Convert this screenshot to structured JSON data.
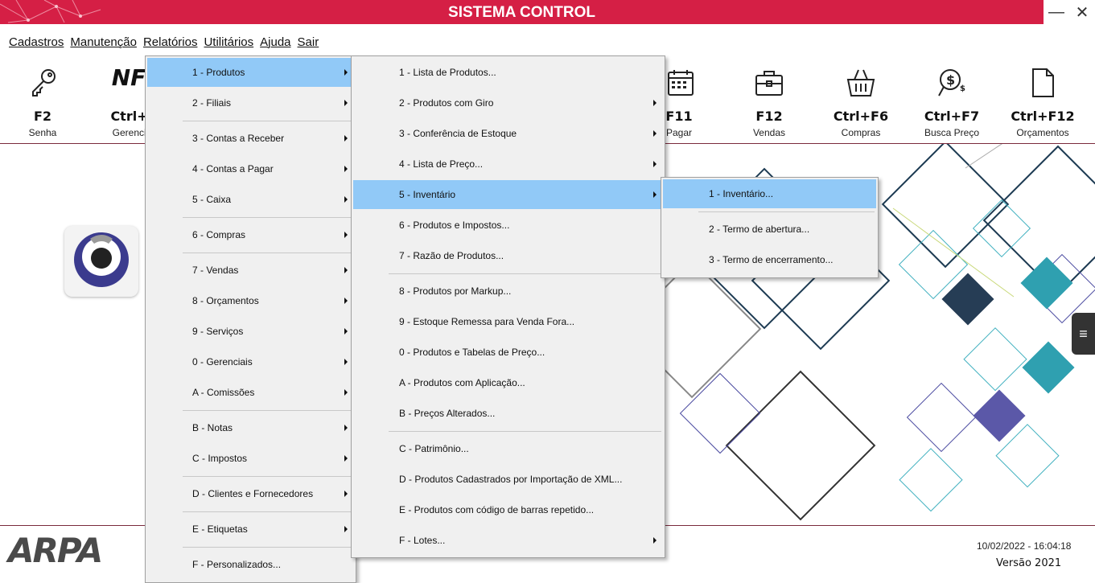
{
  "window": {
    "title": "SISTEMA CONTROL",
    "minimize_glyph": "—",
    "close_glyph": "✕"
  },
  "menubar": [
    "Cadastros",
    "Manutenção",
    "Relatórios",
    "Utilitários",
    "Ajuda",
    "Sair"
  ],
  "toolbar": [
    {
      "key": "F2",
      "label": "Senha",
      "icon": "key-icon"
    },
    {
      "key": "Ctrl+F",
      "label": "Gerenciar",
      "icon": "nfe-icon",
      "logo_text": "NF"
    },
    {
      "key": "F11",
      "label": "Pagar",
      "icon": "calendar-icon"
    },
    {
      "key": "F12",
      "label": "Vendas",
      "icon": "briefcase-icon"
    },
    {
      "key": "Ctrl+F6",
      "label": "Compras",
      "icon": "basket-icon"
    },
    {
      "key": "Ctrl+F7",
      "label": "Busca Preço",
      "icon": "price-search-icon"
    },
    {
      "key": "Ctrl+F12",
      "label": "Orçamentos",
      "icon": "document-icon"
    }
  ],
  "menu_relatorios": [
    {
      "label": "1 - Produtos",
      "submenu": true,
      "highlighted": true
    },
    {
      "label": "2 - Filiais",
      "submenu": true
    },
    {
      "label": "3 - Contas a Receber",
      "submenu": true
    },
    {
      "label": "4 - Contas a Pagar",
      "submenu": true
    },
    {
      "label": "5 - Caixa",
      "submenu": true
    },
    {
      "label": "6 - Compras",
      "submenu": true
    },
    {
      "label": "7 - Vendas",
      "submenu": true
    },
    {
      "label": "8 - Orçamentos",
      "submenu": true
    },
    {
      "label": "9 - Serviços",
      "submenu": true
    },
    {
      "label": "0 - Gerenciais",
      "submenu": true
    },
    {
      "label": "A - Comissões",
      "submenu": true
    },
    {
      "label": "B - Notas",
      "submenu": true
    },
    {
      "label": "C - Impostos",
      "submenu": true
    },
    {
      "label": "D - Clientes e Fornecedores",
      "submenu": true
    },
    {
      "label": "E - Etiquetas",
      "submenu": true
    },
    {
      "label": "F - Personalizados...",
      "submenu": false
    }
  ],
  "menu_produtos": [
    {
      "label": "1 - Lista de Produtos...",
      "submenu": false
    },
    {
      "label": "2 - Produtos com Giro",
      "submenu": true
    },
    {
      "label": "3 - Conferência de Estoque",
      "submenu": true
    },
    {
      "label": "4 - Lista de Preço...",
      "submenu": true
    },
    {
      "label": "5 - Inventário",
      "submenu": true,
      "highlighted": true
    },
    {
      "label": "6 - Produtos e Impostos...",
      "submenu": false
    },
    {
      "label": "7 - Razão de Produtos...",
      "submenu": false
    },
    {
      "label": "8 - Produtos por Markup...",
      "submenu": false
    },
    {
      "label": "9 - Estoque Remessa para Venda Fora...",
      "submenu": false
    },
    {
      "label": "0 - Produtos e Tabelas de Preço...",
      "submenu": false
    },
    {
      "label": "A - Produtos com Aplicação...",
      "submenu": false
    },
    {
      "label": "B - Preços Alterados...",
      "submenu": false
    },
    {
      "label": "C - Patrimônio...",
      "submenu": false
    },
    {
      "label": "D - Produtos Cadastrados por Importação de XML...",
      "submenu": false
    },
    {
      "label": "E - Produtos com código de barras repetido...",
      "submenu": false
    },
    {
      "label": "F - Lotes...",
      "submenu": true
    }
  ],
  "menu_inventario": [
    {
      "label": "1 - Inventário...",
      "highlighted": true
    },
    {
      "label": "2 - Termo de abertura..."
    },
    {
      "label": "3 - Termo de encerramento..."
    }
  ],
  "footer": {
    "datetime": "10/02/2022 - 16:04:18",
    "version": "Versão 2021",
    "logo_text": "ARPA"
  },
  "colors": {
    "titlebar": "#d51f45",
    "highlight": "#91c9f7",
    "menu_bg": "#f0f0f0"
  }
}
